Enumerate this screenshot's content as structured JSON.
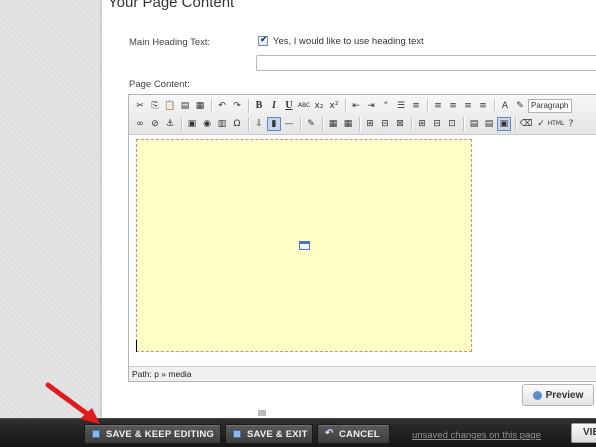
{
  "panel": {
    "title": "Your Page Content",
    "heading_label": "Main Heading Text:",
    "checkbox_label": "Yes, I would like to use heading text",
    "checkbox_checked": true,
    "heading_input_value": "",
    "content_label": "Page Content:"
  },
  "editor": {
    "toolbar_row1": [
      {
        "name": "cut-icon",
        "glyph": "✂"
      },
      {
        "name": "copy-icon",
        "glyph": "⎘"
      },
      {
        "name": "paste-icon",
        "glyph": "📋"
      },
      {
        "name": "paste-text-icon",
        "glyph": "▤"
      },
      {
        "name": "paste-word-icon",
        "glyph": "▦"
      },
      {
        "sep": true
      },
      {
        "name": "undo-icon",
        "glyph": "↶"
      },
      {
        "name": "redo-icon",
        "glyph": "↷"
      },
      {
        "sep": true
      },
      {
        "name": "bold-button",
        "glyph": "B",
        "cls": "bold"
      },
      {
        "name": "italic-button",
        "glyph": "I",
        "cls": "italic"
      },
      {
        "name": "underline-button",
        "glyph": "U",
        "cls": "under"
      },
      {
        "name": "strikethrough-button",
        "glyph": "ABC"
      },
      {
        "name": "subscript-button",
        "glyph": "x₂"
      },
      {
        "name": "superscript-button",
        "glyph": "x²"
      },
      {
        "sep": true
      },
      {
        "name": "outdent-icon",
        "glyph": "⇤"
      },
      {
        "name": "indent-icon",
        "glyph": "⇥"
      },
      {
        "name": "blockquote-icon",
        "glyph": "“"
      },
      {
        "name": "bullet-list-icon",
        "glyph": "☰"
      },
      {
        "name": "numbered-list-icon",
        "glyph": "≡"
      },
      {
        "sep": true
      },
      {
        "name": "align-left-icon",
        "glyph": "≡"
      },
      {
        "name": "align-center-icon",
        "glyph": "≡"
      },
      {
        "name": "align-right-icon",
        "glyph": "≡"
      },
      {
        "name": "align-justify-icon",
        "glyph": "≡"
      },
      {
        "sep": true
      },
      {
        "name": "font-color-icon",
        "glyph": "A"
      },
      {
        "name": "highlight-color-icon",
        "glyph": "✎"
      },
      {
        "format": true
      }
    ],
    "toolbar_row2": [
      {
        "name": "link-icon",
        "glyph": "∞"
      },
      {
        "name": "unlink-icon",
        "glyph": "⊘"
      },
      {
        "name": "anchor-icon",
        "glyph": "⚓"
      },
      {
        "sep": true
      },
      {
        "name": "image-icon",
        "glyph": "▣"
      },
      {
        "name": "flash-icon",
        "glyph": "◉"
      },
      {
        "name": "media-icon",
        "glyph": "▥"
      },
      {
        "name": "special-char-icon",
        "glyph": "Ω"
      },
      {
        "sep": true
      },
      {
        "name": "insert-file-icon",
        "glyph": "⇩"
      },
      {
        "name": "embed-media-icon",
        "glyph": "▮",
        "active": true
      },
      {
        "name": "horizontal-rule-icon",
        "glyph": "—"
      },
      {
        "sep": true
      },
      {
        "name": "edit-icon",
        "glyph": "✎"
      },
      {
        "sep": true
      },
      {
        "name": "table-icon",
        "glyph": "▦"
      },
      {
        "name": "table-props-icon",
        "glyph": "▦"
      },
      {
        "sep": true
      },
      {
        "name": "row-insert-icon",
        "glyph": "⊞"
      },
      {
        "name": "row-delete-icon",
        "glyph": "⊟"
      },
      {
        "name": "merge-cells-icon",
        "glyph": "⊠"
      },
      {
        "sep": true
      },
      {
        "name": "col-insert-icon",
        "glyph": "⊞"
      },
      {
        "name": "col-delete-icon",
        "glyph": "⊟"
      },
      {
        "name": "split-cells-icon",
        "glyph": "⊡"
      },
      {
        "sep": true
      },
      {
        "name": "visual-aid-icon",
        "glyph": "▤"
      },
      {
        "name": "source-view-icon",
        "glyph": "▤"
      },
      {
        "name": "fullscreen-icon",
        "glyph": "▣",
        "active": true
      },
      {
        "sep": true
      },
      {
        "name": "remove-format-icon",
        "glyph": "⌫"
      },
      {
        "name": "clean-icon",
        "glyph": "✓"
      },
      {
        "name": "html-icon",
        "glyph": "HTML"
      },
      {
        "name": "help-icon",
        "glyph": "?"
      }
    ],
    "format_select": "Paragraph",
    "status_path": "Path: p » media"
  },
  "preview_label": "Preview",
  "bottom_bar": {
    "save_keep_label": "SAVE & KEEP EDITING",
    "save_exit_label": "SAVE & EXIT",
    "cancel_label": "CANCEL",
    "unsaved_text": "unsaved changes on this page",
    "view_label": "VIE"
  },
  "colors": {
    "bottom_bar": "#1e1e1e",
    "media_fill": "#ffffc6",
    "arrow": "#e11b1b"
  }
}
